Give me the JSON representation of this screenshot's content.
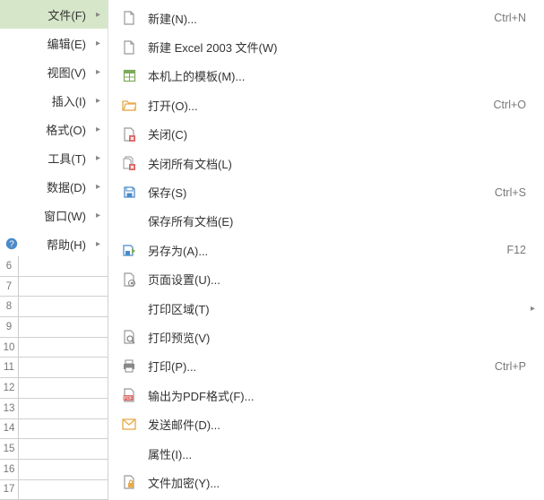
{
  "menubar": {
    "items": [
      {
        "label": "文件(F)",
        "active": true,
        "has_arrow": true
      },
      {
        "label": "编辑(E)",
        "active": false,
        "has_arrow": true
      },
      {
        "label": "视图(V)",
        "active": false,
        "has_arrow": true
      },
      {
        "label": "插入(I)",
        "active": false,
        "has_arrow": true
      },
      {
        "label": "格式(O)",
        "active": false,
        "has_arrow": true
      },
      {
        "label": "工具(T)",
        "active": false,
        "has_arrow": true
      },
      {
        "label": "数据(D)",
        "active": false,
        "has_arrow": true
      },
      {
        "label": "窗口(W)",
        "active": false,
        "has_arrow": true
      },
      {
        "label": "帮助(H)",
        "active": false,
        "has_arrow": true,
        "help_icon": true
      }
    ]
  },
  "submenu": {
    "items": [
      {
        "icon": "new-doc-icon",
        "label": "新建(N)...",
        "shortcut": "Ctrl+N"
      },
      {
        "icon": "new-doc-icon",
        "label": "新建 Excel 2003 文件(W)",
        "shortcut": ""
      },
      {
        "icon": "template-icon",
        "label": "本机上的模板(M)...",
        "shortcut": ""
      },
      {
        "icon": "open-icon",
        "label": "打开(O)...",
        "shortcut": "Ctrl+O"
      },
      {
        "icon": "close-icon",
        "label": "关闭(C)",
        "shortcut": ""
      },
      {
        "icon": "close-all-icon",
        "label": "关闭所有文档(L)",
        "shortcut": ""
      },
      {
        "icon": "save-icon",
        "label": "保存(S)",
        "shortcut": "Ctrl+S"
      },
      {
        "icon": "",
        "label": "保存所有文档(E)",
        "shortcut": ""
      },
      {
        "icon": "save-as-icon",
        "label": "另存为(A)...",
        "shortcut": "F12"
      },
      {
        "icon": "page-setup-icon",
        "label": "页面设置(U)...",
        "shortcut": ""
      },
      {
        "icon": "",
        "label": "打印区域(T)",
        "shortcut": "",
        "has_sub": true
      },
      {
        "icon": "preview-icon",
        "label": "打印预览(V)",
        "shortcut": ""
      },
      {
        "icon": "print-icon",
        "label": "打印(P)...",
        "shortcut": "Ctrl+P"
      },
      {
        "icon": "pdf-icon",
        "label": "输出为PDF格式(F)...",
        "shortcut": ""
      },
      {
        "icon": "mail-icon",
        "label": "发送邮件(D)...",
        "shortcut": ""
      },
      {
        "icon": "",
        "label": "属性(I)...",
        "shortcut": ""
      },
      {
        "icon": "encrypt-icon",
        "label": "文件加密(Y)...",
        "shortcut": ""
      }
    ]
  },
  "rows": [
    "6",
    "7",
    "8",
    "9",
    "10",
    "11",
    "12",
    "13",
    "14",
    "15",
    "16",
    "17"
  ],
  "colors": {
    "active_menu_bg": "#d6e7c9",
    "icon_orange": "#e8a949",
    "icon_blue": "#4a8ac9",
    "icon_green": "#7bab5a",
    "icon_red": "#d66"
  }
}
